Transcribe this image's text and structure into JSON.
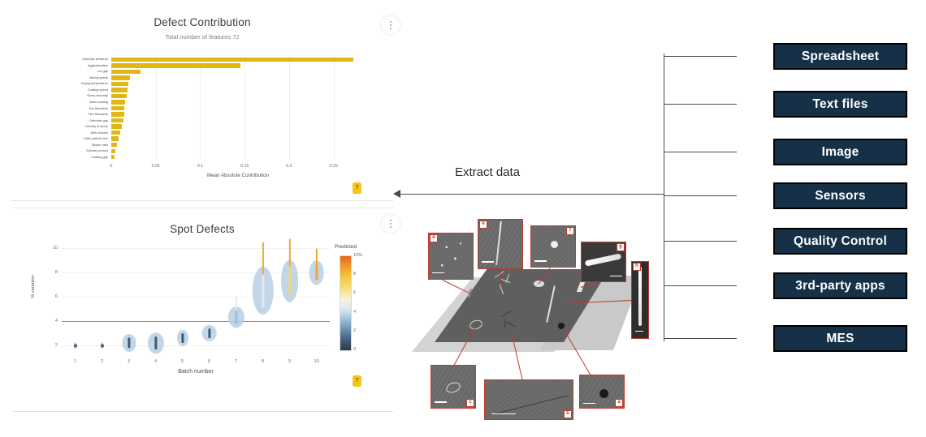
{
  "dashboard": {
    "bar_card": {
      "title": "Defect Contribution",
      "subtitle": "Total number of features  72",
      "menu_icon": "kebab-menu-icon",
      "badge": "?"
    },
    "violin_card": {
      "title": "Spot Defects",
      "menu_icon": "kebab-menu-icon",
      "badge": "?"
    }
  },
  "chart_data": [
    {
      "type": "bar",
      "title": "Defect Contribution",
      "subtitle": "Total number of features  72",
      "orientation": "horizontal",
      "xlabel": "Mean Absolute Contribution",
      "ylabel": "",
      "xlim": [
        0,
        0.285
      ],
      "xticks": [
        "0",
        "0.05",
        "0.1",
        "0.15",
        "0.2",
        "0.25"
      ],
      "xtick_values": [
        0,
        0.05,
        0.1,
        0.15,
        0.2,
        0.25
      ],
      "grid": true,
      "bar_color": "#e2b714",
      "categories": [
        "Calendar pressure",
        "Agglomeration",
        "Lot gap",
        "Mixing speed",
        "Drying temperature",
        "Coating speed",
        "Slurry viscosity",
        "Mass loading",
        "Dry thickness",
        "Film thickness",
        "Calendar gap",
        "Density of slurry",
        "Web tension",
        "CAM particle size",
        "Binder ratio",
        "Solvent content",
        "Coating gap"
      ],
      "values": [
        0.272,
        0.145,
        0.033,
        0.021,
        0.019,
        0.018,
        0.017,
        0.0155,
        0.015,
        0.0145,
        0.0135,
        0.012,
        0.0105,
        0.008,
        0.0065,
        0.005,
        0.004
      ]
    },
    {
      "type": "violin",
      "title": "Spot Defects",
      "xlabel": "Batch number",
      "ylabel": "% variation",
      "ylim": [
        1.2,
        10.4
      ],
      "yticks": [
        "2",
        "4",
        "6",
        "8",
        "10"
      ],
      "ytick_values": [
        2,
        4,
        6,
        8,
        10
      ],
      "xticks": [
        "1",
        "2",
        "3",
        "4",
        "5",
        "6",
        "7",
        "8",
        "9",
        "10"
      ],
      "reference_line": 4,
      "grid": true,
      "categories": [
        1,
        2,
        3,
        4,
        5,
        6,
        7,
        8,
        9,
        10
      ],
      "centers": [
        2.0,
        2.0,
        2.2,
        2.2,
        2.6,
        3.0,
        4.3,
        6.5,
        7.3,
        8.0
      ],
      "spreads": [
        0.12,
        0.12,
        0.5,
        0.6,
        0.45,
        0.45,
        0.6,
        1.5,
        1.3,
        0.7
      ],
      "widths": [
        6,
        6,
        22,
        26,
        18,
        24,
        26,
        34,
        28,
        24
      ],
      "colorbar": {
        "title": "Predicted",
        "ticks": [
          "10%",
          "8",
          "6",
          "4",
          "2",
          "0"
        ],
        "tick_values": [
          10,
          8,
          6,
          4,
          2,
          0
        ],
        "low_color": "#2b3a4a",
        "mid_color": "#dce9f2",
        "high_color": "#e8611c"
      }
    }
  ],
  "flow": {
    "extract_label": "Extract data",
    "arrow_icon": "left-arrow-icon",
    "bus_icon": "bus-line"
  },
  "sources": {
    "items": [
      {
        "label": "Spreadsheet"
      },
      {
        "label": "Text files"
      },
      {
        "label": "Image"
      },
      {
        "label": "Sensors"
      },
      {
        "label": "Quality Control"
      },
      {
        "label": "3rd-party apps"
      },
      {
        "label": "MES"
      }
    ],
    "button_color": "#153047",
    "border_color": "#000000",
    "text_color": "#ffffff"
  },
  "montage": {
    "description": "SEM defect montage on electrode sheet",
    "accent_color": "#c0392b",
    "panels": [
      {
        "id": "a",
        "defect": "pinhole"
      },
      {
        "id": "b",
        "defect": "streak"
      },
      {
        "id": "c",
        "defect": "scratch"
      },
      {
        "id": "d",
        "defect": "agglomerates"
      },
      {
        "id": "e",
        "defect": "crack"
      },
      {
        "id": "f",
        "defect": "blister"
      },
      {
        "id": "g",
        "defect": "edge-burr"
      },
      {
        "id": "h",
        "defect": "line-defect"
      }
    ]
  }
}
